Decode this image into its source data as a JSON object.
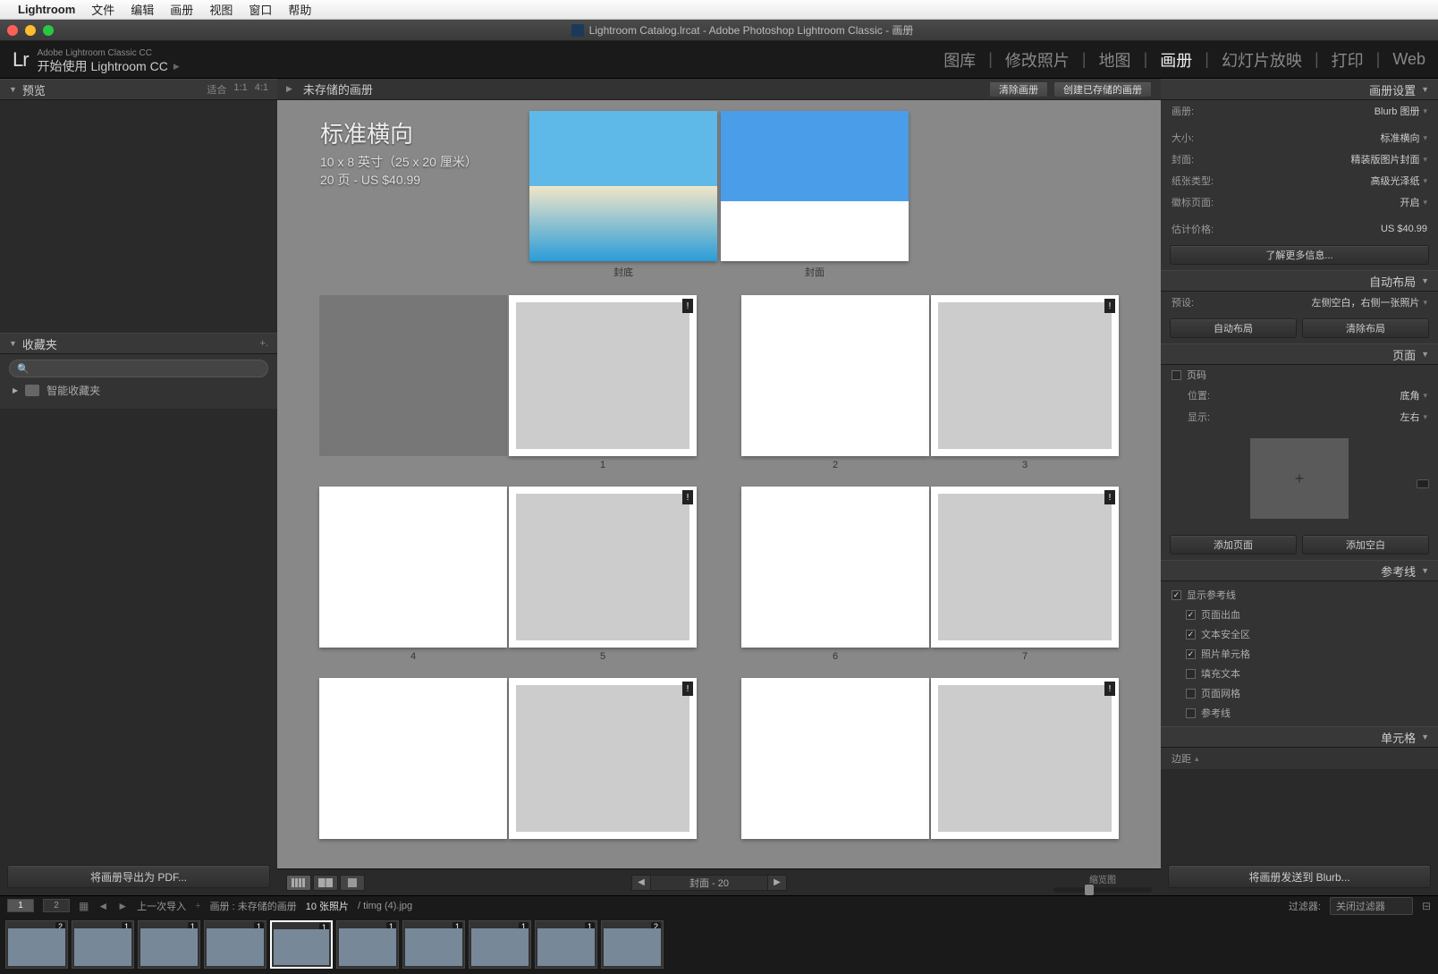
{
  "menubar": {
    "app": "Lightroom",
    "items": [
      "文件",
      "编辑",
      "画册",
      "视图",
      "窗口",
      "帮助"
    ]
  },
  "window_title": "Lightroom Catalog.lrcat - Adobe Photoshop Lightroom Classic - 画册",
  "app_header": {
    "line1": "Adobe Lightroom Classic CC",
    "line2": "开始使用 Lightroom CC"
  },
  "modules": [
    "图库",
    "修改照片",
    "地图",
    "画册",
    "幻灯片放映",
    "打印",
    "Web"
  ],
  "active_module": "画册",
  "left": {
    "preview": {
      "title": "预览",
      "fit": "适合",
      "r1": "1:1",
      "r2": "4:1"
    },
    "favorites": {
      "title": "收藏夹",
      "search_placeholder": "搜索",
      "smart": "智能收藏夹"
    },
    "export_btn": "将画册导出为 PDF..."
  },
  "subbar": {
    "crumb": "未存储的画册",
    "clear": "清除画册",
    "create": "创建已存储的画册"
  },
  "book": {
    "t1": "标准横向",
    "t2": "10 x 8 英寸（25 x 20 厘米）",
    "t3": "20 页 - US $40.99",
    "back": "封底",
    "front": "封面"
  },
  "pager": {
    "label": "封面 - 20",
    "thumb_label": "缩览图"
  },
  "right": {
    "book_settings": {
      "title": "画册设置",
      "book": "画册:",
      "book_v": "Blurb 图册",
      "size": "大小:",
      "size_v": "标准横向",
      "cover": "封面:",
      "cover_v": "精装版图片封面",
      "paper": "纸张类型:",
      "paper_v": "高级光泽纸",
      "logo": "徽标页面:",
      "logo_v": "开启",
      "est": "估计价格:",
      "est_v": "US $40.99",
      "more": "了解更多信息..."
    },
    "auto_layout": {
      "title": "自动布局",
      "preset": "预设:",
      "preset_v": "左侧空白，右侧一张照片",
      "auto_btn": "自动布局",
      "clear_btn": "清除布局"
    },
    "page": {
      "title": "页面",
      "page_num": "页码",
      "pos": "位置:",
      "pos_v": "底角",
      "disp": "显示:",
      "disp_v": "左右",
      "add_page": "添加页面",
      "add_blank": "添加空白"
    },
    "guides": {
      "title": "参考线",
      "show": "显示参考线",
      "bleed": "页面出血",
      "safe": "文本安全区",
      "cells": "照片单元格",
      "fill": "填充文本",
      "grid": "页面网格",
      "guide": "参考线"
    },
    "cell": {
      "title": "单元格",
      "margin": "边距"
    },
    "send_btn": "将画册发送到 Blurb..."
  },
  "footer": {
    "prev_import": "上一次导入",
    "book": "画册 : 未存储的画册",
    "count": "10 张照片",
    "fname": "/ timg (4).jpg",
    "filter": "过滤器:",
    "filter_v": "关闭过滤器"
  },
  "filmstrip_badges": [
    "2",
    "1",
    "1",
    "1",
    "1",
    "1",
    "1",
    "1",
    "1",
    "2"
  ]
}
